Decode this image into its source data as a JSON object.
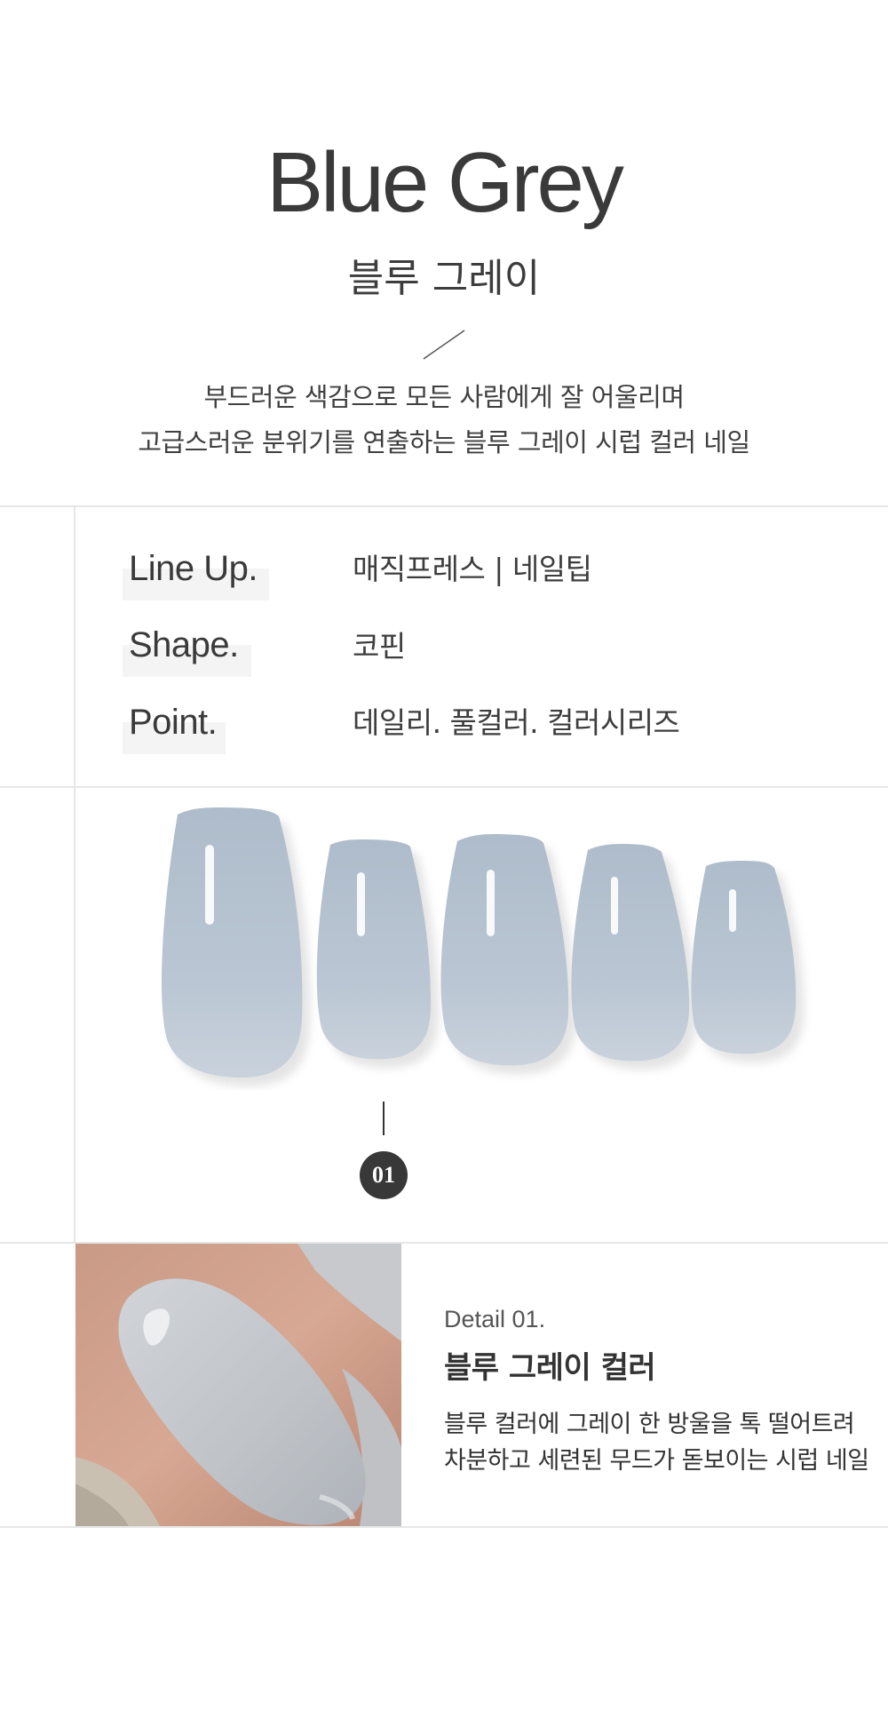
{
  "hero": {
    "title": "Blue Grey",
    "subtitle": "블루 그레이",
    "description_lines": [
      "부드러운 색감으로 모든 사람에게 잘 어울리며",
      "고급스러운 분위기를 연출하는 블루 그레이 시럽 컬러 네일"
    ]
  },
  "spec": {
    "rows": [
      {
        "label": "Line Up.",
        "value": "매직프레스 | 네일팁"
      },
      {
        "label": "Shape.",
        "value": "코핀"
      },
      {
        "label": "Point.",
        "value": "데일리. 풀컬러. 컬러시리즈"
      }
    ]
  },
  "product": {
    "nail_color": "#b9c5d2",
    "nail_count": 5,
    "badge": "01"
  },
  "detail": {
    "label": "Detail 01.",
    "heading": "블루 그레이 컬러",
    "description_lines": [
      "블루 컬러에 그레이 한 방울을 톡 떨어트려",
      "차분하고 세련된 무드가 돋보이는 시럽 네일"
    ]
  }
}
